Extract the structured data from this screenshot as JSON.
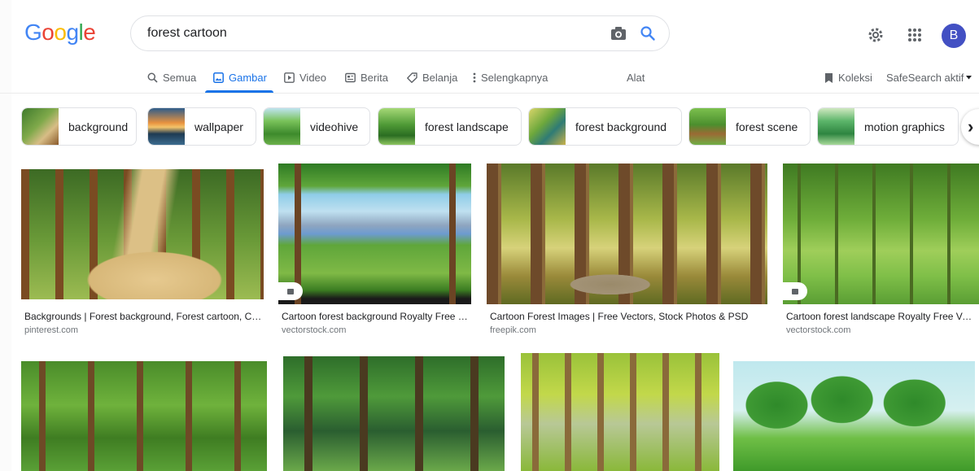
{
  "header": {
    "logo_letters": [
      {
        "ch": "G",
        "color": "#4285f4"
      },
      {
        "ch": "o",
        "color": "#ea4335"
      },
      {
        "ch": "o",
        "color": "#fbbc05"
      },
      {
        "ch": "g",
        "color": "#4285f4"
      },
      {
        "ch": "l",
        "color": "#34a853"
      },
      {
        "ch": "e",
        "color": "#ea4335"
      }
    ],
    "search_value": "forest cartoon",
    "avatar_letter": "B"
  },
  "tabs": {
    "all": "Semua",
    "images": "Gambar",
    "video": "Video",
    "news": "Berita",
    "shopping": "Belanja",
    "more": "Selengkapnya",
    "tools": "Alat",
    "collections": "Koleksi",
    "safesearch": "SafeSearch aktif"
  },
  "chips": [
    {
      "label": "background",
      "colors": [
        "#6b8f3a",
        "#c9a86b"
      ]
    },
    {
      "label": "wallpaper",
      "colors": [
        "#e58a3b",
        "#254a6e"
      ]
    },
    {
      "label": "videohive",
      "colors": [
        "#8fcf6e",
        "#3f7d2f"
      ]
    },
    {
      "label": "forest landscape",
      "colors": [
        "#9ed36a",
        "#2f6b25"
      ]
    },
    {
      "label": "forest background",
      "colors": [
        "#c7d66a",
        "#2d6e6a"
      ]
    },
    {
      "label": "forest scene",
      "colors": [
        "#6fb44a",
        "#8a5a2b"
      ]
    },
    {
      "label": "motion graphics",
      "colors": [
        "#57b365",
        "#c7e4b5"
      ]
    }
  ],
  "results": [
    {
      "caption": "Backgrounds | Forest background, Forest cartoon, Ca...",
      "source": "pinterest.com"
    },
    {
      "caption": "Cartoon forest background Royalty Free V...",
      "source": "vectorstock.com"
    },
    {
      "caption": "Cartoon Forest Images | Free Vectors, Stock Photos & PSD",
      "source": "freepik.com"
    },
    {
      "caption": "Cartoon forest landscape Royalty Free Ve...",
      "source": "vectorstock.com"
    }
  ],
  "icons": {
    "search": "search-icon",
    "camera": "camera-icon",
    "settings": "settings-gear-icon",
    "apps": "apps-grid-icon"
  },
  "colors": {
    "accent": "#1a73e8",
    "avatar": "#4350c3"
  }
}
